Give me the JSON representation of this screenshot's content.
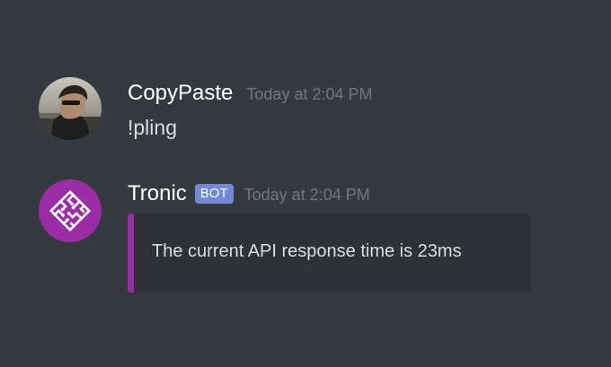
{
  "messages": [
    {
      "author": "CopyPaste",
      "timestamp": "Today at 2:04 PM",
      "content": "!pling",
      "avatar_icon": "user-photo-avatar"
    },
    {
      "author": "Tronic",
      "badge": "BOT",
      "timestamp": "Today at 2:04 PM",
      "avatar_icon": "circuit-logo-avatar",
      "embed": {
        "description": "The current API response time is 23ms",
        "accent_color": "#9b2ea6"
      }
    }
  ],
  "colors": {
    "background": "#36393f",
    "embed_background": "#2f3136",
    "bot_badge": "#7289da",
    "timestamp": "#72767d",
    "text": "#dcddde",
    "username": "#ffffff",
    "bot_avatar": "#9b2ea6"
  }
}
